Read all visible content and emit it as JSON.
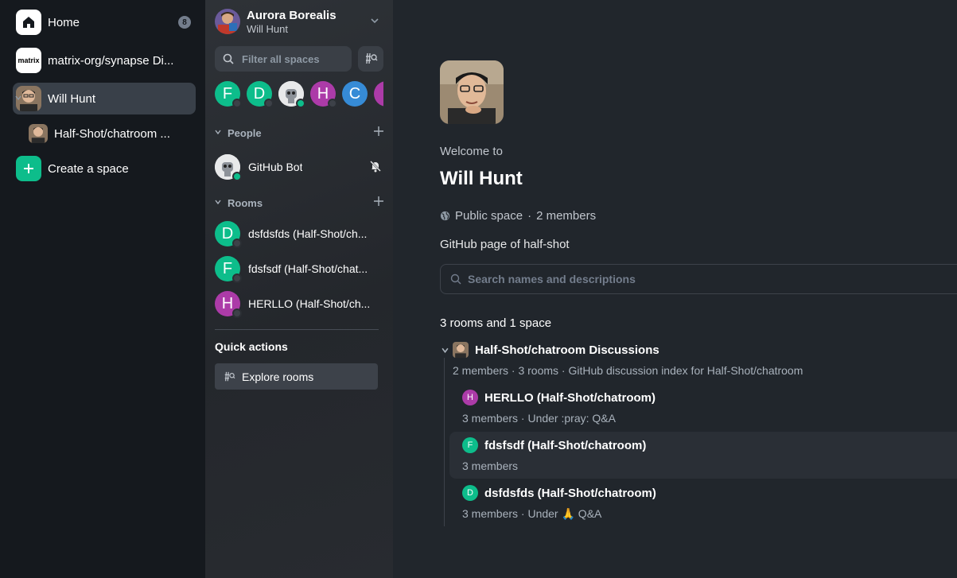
{
  "colors": {
    "accent": "#0dbd8b",
    "avatar_green": "#0dbd8b",
    "avatar_purple": "#ac3ba8",
    "avatar_blue": "#368bd6",
    "sidebar_bg": "#15191e",
    "main_bg": "#21262c"
  },
  "spaces": {
    "home": {
      "label": "Home",
      "badge": "8",
      "icon": "home-icon"
    },
    "matrix": {
      "label": "matrix-org/synapse Di...",
      "logo_text": "matrix"
    },
    "will_hunt": {
      "label": "Will Hunt"
    },
    "chatroom": {
      "label": "Half-Shot/chatroom ..."
    },
    "create": {
      "label": "Create a space",
      "icon": "plus-icon"
    }
  },
  "roomlist": {
    "header": {
      "title": "Aurora Borealis",
      "subtitle": "Will Hunt"
    },
    "filter_placeholder": "Filter all spaces",
    "breadcrumbs": [
      {
        "letter": "F",
        "color": "#0dbd8b"
      },
      {
        "letter": "D",
        "color": "#0dbd8b"
      },
      {
        "letter": "",
        "color": "#e8e9ea"
      },
      {
        "letter": "H",
        "color": "#ac3ba8"
      },
      {
        "letter": "C",
        "color": "#368bd6"
      },
      {
        "letter": "",
        "color": "#ac3ba8"
      }
    ],
    "people_label": "People",
    "people": [
      {
        "name": "GitHub Bot"
      }
    ],
    "rooms_label": "Rooms",
    "rooms": [
      {
        "letter": "D",
        "name": "dsfdsfds (Half-Shot/ch...",
        "color": "#0dbd8b"
      },
      {
        "letter": "F",
        "name": "fdsfsdf (Half-Shot/chat...",
        "color": "#0dbd8b"
      },
      {
        "letter": "H",
        "name": "HERLLO (Half-Shot/ch...",
        "color": "#ac3ba8"
      }
    ],
    "quick_actions_title": "Quick actions",
    "explore_label": "Explore rooms"
  },
  "main": {
    "welcome": "Welcome to",
    "space_name": "Will Hunt",
    "visibility": "Public space",
    "separator": "·",
    "members": "2 members",
    "topic": "GitHub page of half-shot",
    "search_placeholder": "Search names and descriptions",
    "count": "3 rooms and 1 space",
    "hierarchy": {
      "space": {
        "name": "Half-Shot/chatroom Discussions",
        "meta": "2 members · 3 rooms · GitHub discussion index for Half-Shot/chatroom"
      },
      "rooms": [
        {
          "letter": "H",
          "name": "HERLLO (Half-Shot/chatroom)",
          "meta": "3 members · Under :pray: Q&A",
          "color": "#ac3ba8"
        },
        {
          "letter": "F",
          "name": "fdsfsdf (Half-Shot/chatroom)",
          "meta": "3 members",
          "color": "#0dbd8b"
        },
        {
          "letter": "D",
          "name": "dsfdsfds (Half-Shot/chatroom)",
          "meta": "3 members · Under 🙏 Q&A",
          "color": "#0dbd8b"
        }
      ]
    }
  }
}
